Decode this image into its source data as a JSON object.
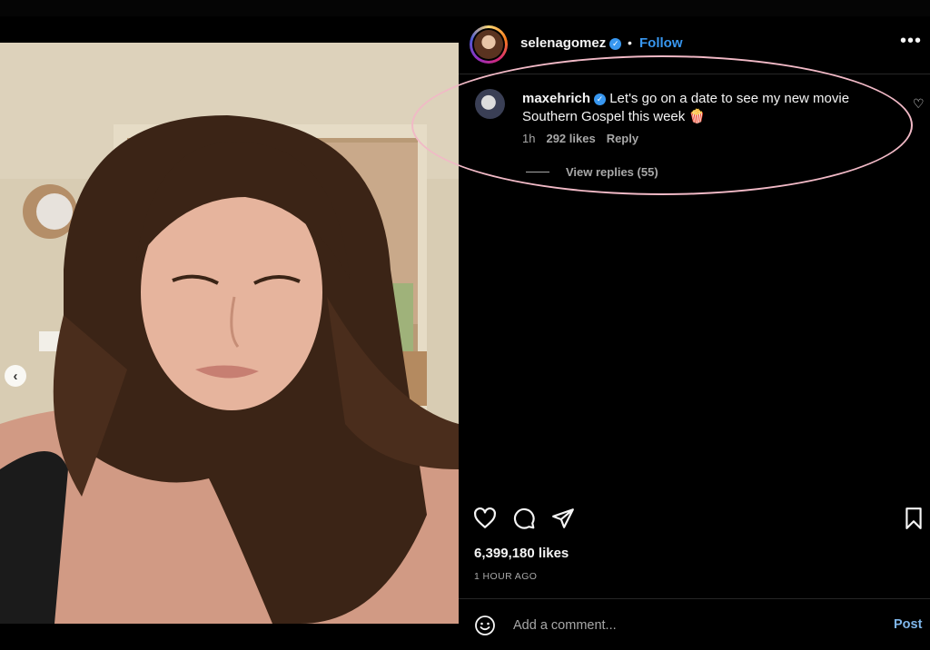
{
  "post": {
    "owner": "selenagomez",
    "separator": "•",
    "follow_label": "Follow",
    "more_label": "•••"
  },
  "comment": {
    "username": "maxehrich",
    "text": "Let's go on a date to see my new movie Southern Gospel this week 🍿",
    "time": "1h",
    "likes": "292 likes",
    "reply_label": "Reply",
    "view_replies": "View replies (55)"
  },
  "stats": {
    "likes": "6,399,180 likes",
    "time": "1 HOUR AGO"
  },
  "comment_box": {
    "placeholder": "Add a comment...",
    "post_label": "Post"
  },
  "carousel": {
    "slides": 2,
    "active_index": 1
  },
  "colors": {
    "accent": "#3897f0",
    "highlight": "#f1b9c6",
    "background": "#000000"
  },
  "icons": [
    "heart-icon",
    "comment-icon",
    "share-icon",
    "bookmark-icon",
    "emoji-icon",
    "verified-icon",
    "chevron-left-icon"
  ]
}
